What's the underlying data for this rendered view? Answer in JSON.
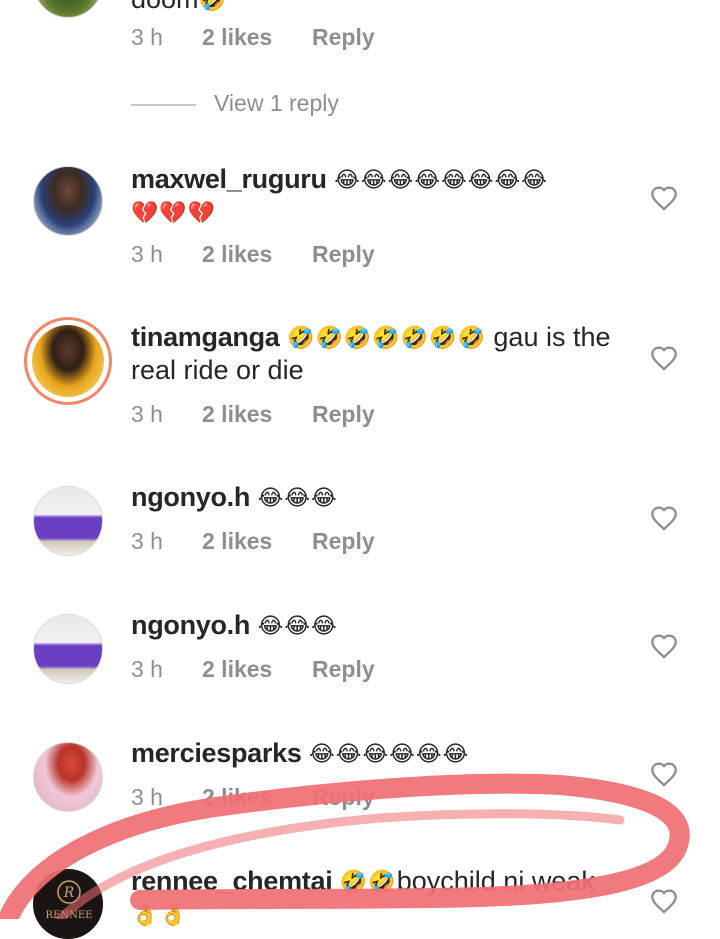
{
  "comments": [
    {
      "username": "",
      "text": "doom",
      "emojis": [
        "🤣"
      ],
      "time": "3 h",
      "likes": "2 likes",
      "reply": "Reply",
      "view_replies": "View 1 reply"
    },
    {
      "username": "maxwel_ruguru",
      "emojis": [
        "😂",
        "😂",
        "😂",
        "😂",
        "😂",
        "😂",
        "😂",
        "😂"
      ],
      "emojis_line2": [
        "💔",
        "💔",
        "💔"
      ],
      "time": "3 h",
      "likes": "2 likes",
      "reply": "Reply"
    },
    {
      "username": "tinamganga",
      "emojis": [
        "🤣",
        "🤣",
        "🤣",
        "🤣",
        "🤣",
        "🤣",
        "🤣"
      ],
      "text": "gau is the real ride or die",
      "time": "3 h",
      "likes": "2 likes",
      "reply": "Reply"
    },
    {
      "username": "ngonyo.h",
      "emojis": [
        "😂",
        "😂",
        "😂"
      ],
      "time": "3 h",
      "likes": "2 likes",
      "reply": "Reply"
    },
    {
      "username": "ngonyo.h",
      "emojis": [
        "😂",
        "😂",
        "😂"
      ],
      "time": "3 h",
      "likes": "2 likes",
      "reply": "Reply"
    },
    {
      "username": "merciesparks",
      "emojis": [
        "😂",
        "😂",
        "😂",
        "😂",
        "😂",
        "😂"
      ],
      "time": "3 h",
      "likes": "2 likes",
      "reply": "Reply"
    },
    {
      "username": "rennee_chemtai",
      "emojis": [
        "🤣",
        "🤣"
      ],
      "text": "boychild ni weak",
      "emojis_line2": [
        "👌",
        "👌"
      ],
      "avatar_logo_letter": "R",
      "avatar_logo_text": "RENNEE"
    }
  ],
  "colors": {
    "text": "#262626",
    "secondary": "#8e8e8e",
    "story_ring": "#f4856a",
    "annotation": "#ef6f72"
  }
}
